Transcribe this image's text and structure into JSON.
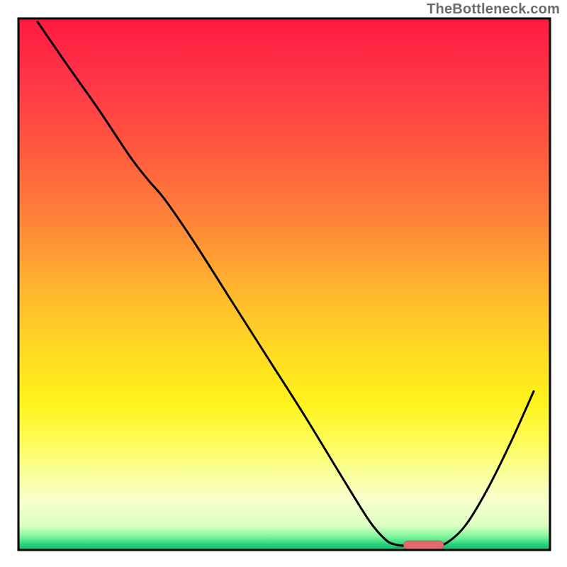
{
  "watermark": "TheBottleneck.com",
  "colors": {
    "gradient_stops": [
      {
        "offset": 0.0,
        "color": "#ff1a40"
      },
      {
        "offset": 0.12,
        "color": "#ff3648"
      },
      {
        "offset": 0.25,
        "color": "#ff5a3f"
      },
      {
        "offset": 0.38,
        "color": "#ff8438"
      },
      {
        "offset": 0.5,
        "color": "#ffb22f"
      },
      {
        "offset": 0.62,
        "color": "#ffd824"
      },
      {
        "offset": 0.72,
        "color": "#fff21a"
      },
      {
        "offset": 0.8,
        "color": "#fdfd5a"
      },
      {
        "offset": 0.86,
        "color": "#faffa0"
      },
      {
        "offset": 0.91,
        "color": "#f7ffd0"
      },
      {
        "offset": 0.955,
        "color": "#d8ffbf"
      },
      {
        "offset": 0.975,
        "color": "#7ef59a"
      },
      {
        "offset": 0.99,
        "color": "#25d17d"
      },
      {
        "offset": 1.0,
        "color": "#18b56d"
      }
    ],
    "curve": "#000000",
    "marker_fill": "#e26a6a",
    "marker_stroke": "#d05757",
    "frame": "#000000"
  },
  "chart_data": {
    "type": "line",
    "title": "",
    "xlabel": "",
    "ylabel": "",
    "x_range": [
      0,
      100
    ],
    "y_range": [
      0,
      100
    ],
    "curve_points": [
      {
        "x": 3.5,
        "y": 99.5
      },
      {
        "x": 9.0,
        "y": 91.5
      },
      {
        "x": 15.0,
        "y": 83.0
      },
      {
        "x": 21.0,
        "y": 74.0
      },
      {
        "x": 24.5,
        "y": 69.5
      },
      {
        "x": 27.5,
        "y": 66.0
      },
      {
        "x": 33.0,
        "y": 58.0
      },
      {
        "x": 40.0,
        "y": 47.0
      },
      {
        "x": 47.0,
        "y": 36.0
      },
      {
        "x": 54.0,
        "y": 25.0
      },
      {
        "x": 61.0,
        "y": 13.5
      },
      {
        "x": 66.0,
        "y": 5.5
      },
      {
        "x": 69.0,
        "y": 2.0
      },
      {
        "x": 71.0,
        "y": 1.0
      },
      {
        "x": 74.0,
        "y": 0.7
      },
      {
        "x": 78.0,
        "y": 0.7
      },
      {
        "x": 80.5,
        "y": 1.3
      },
      {
        "x": 84.0,
        "y": 4.5
      },
      {
        "x": 88.0,
        "y": 11.0
      },
      {
        "x": 92.5,
        "y": 20.0
      },
      {
        "x": 97.0,
        "y": 30.0
      }
    ],
    "marker": {
      "x_start": 72.5,
      "x_end": 80.0,
      "y": 0.9
    }
  }
}
